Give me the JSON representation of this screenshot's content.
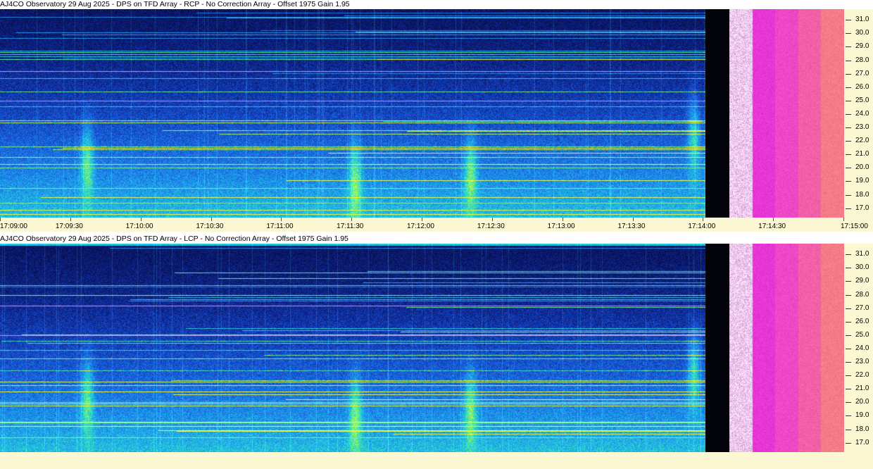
{
  "panels": [
    {
      "title": "AJ4CO Observatory 29 Aug 2025 - DPS on TFD Array  - RCP  -  No Correction Array  -  Offset 1975  Gain 1.95",
      "polarization": "RCP",
      "show_time_axis": true
    },
    {
      "title": "AJ4CO Observatory 29 Aug 2025 - DPS on TFD Array  - LCP  -  No Correction Array  -  Offset 1975  Gain 1.95",
      "polarization": "LCP",
      "show_time_axis": false
    }
  ],
  "time_axis": {
    "labels": [
      "17:09:00",
      "17:09:30",
      "17:10:00",
      "17:10:30",
      "17:11:00",
      "17:11:30",
      "17:12:00",
      "17:12:30",
      "17:13:00",
      "17:13:30",
      "17:14:00",
      "17:14:30",
      "17:15:00"
    ]
  },
  "freq_axis": {
    "labels": [
      "31.0",
      "30.0",
      "29.0",
      "28.0",
      "27.0",
      "26.0",
      "25.0",
      "24.0",
      "23.0",
      "22.0",
      "21.0",
      "20.0",
      "19.0",
      "18.0",
      "17.0"
    ],
    "unit": ""
  },
  "colors": {
    "axis_background": "#fdf8d4",
    "spectrogram_low": "#0a1550",
    "spectrogram_mid": "#1f7ae0",
    "spectrogram_high": "#a0f050",
    "colorbar": [
      "#f2c8f2",
      "#e636d6",
      "#ee48c6",
      "#f260a8",
      "#f47c88"
    ]
  },
  "chart_data": [
    {
      "type": "heatmap",
      "title": "AJ4CO Observatory 29 Aug 2025 - DPS on TFD Array  - RCP  -  No Correction Array  -  Offset 1975  Gain 1.95",
      "xlabel": "",
      "ylabel": "",
      "x_ticks": [
        "17:09:00",
        "17:09:30",
        "17:10:00",
        "17:10:30",
        "17:11:00",
        "17:11:30",
        "17:12:00",
        "17:12:30",
        "17:13:00",
        "17:13:30",
        "17:14:00",
        "17:14:30",
        "17:15:00"
      ],
      "y_ticks": [
        31.0,
        30.0,
        29.0,
        28.0,
        27.0,
        26.0,
        25.0,
        24.0,
        23.0,
        22.0,
        21.0,
        20.0,
        19.0,
        18.0,
        17.0
      ],
      "xlim": [
        "17:09:00",
        "17:15:00"
      ],
      "ylim": [
        16.3,
        31.8
      ],
      "bright_bursts": [
        {
          "time": "17:09:37",
          "freq_center": 20.5
        },
        {
          "time": "17:11:31",
          "freq_center": 19.2
        },
        {
          "time": "17:12:20",
          "freq_center": 19.6
        },
        {
          "time": "17:13:55",
          "freq_center": 22.5
        }
      ],
      "grid": false
    },
    {
      "type": "heatmap",
      "title": "AJ4CO Observatory 29 Aug 2025 - DPS on TFD Array  - LCP  -  No Correction Array  -  Offset 1975  Gain 1.95",
      "xlabel": "",
      "ylabel": "",
      "y_ticks": [
        31.0,
        30.0,
        29.0,
        28.0,
        27.0,
        26.0,
        25.0,
        24.0,
        23.0,
        22.0,
        21.0,
        20.0,
        19.0,
        18.0,
        17.0
      ],
      "ylim": [
        16.3,
        31.8
      ],
      "bright_bursts": [
        {
          "time": "17:09:37",
          "freq_center": 20.5
        },
        {
          "time": "17:11:31",
          "freq_center": 19.2
        },
        {
          "time": "17:12:20",
          "freq_center": 19.6
        },
        {
          "time": "17:13:55",
          "freq_center": 22.5
        }
      ],
      "grid": false
    }
  ]
}
